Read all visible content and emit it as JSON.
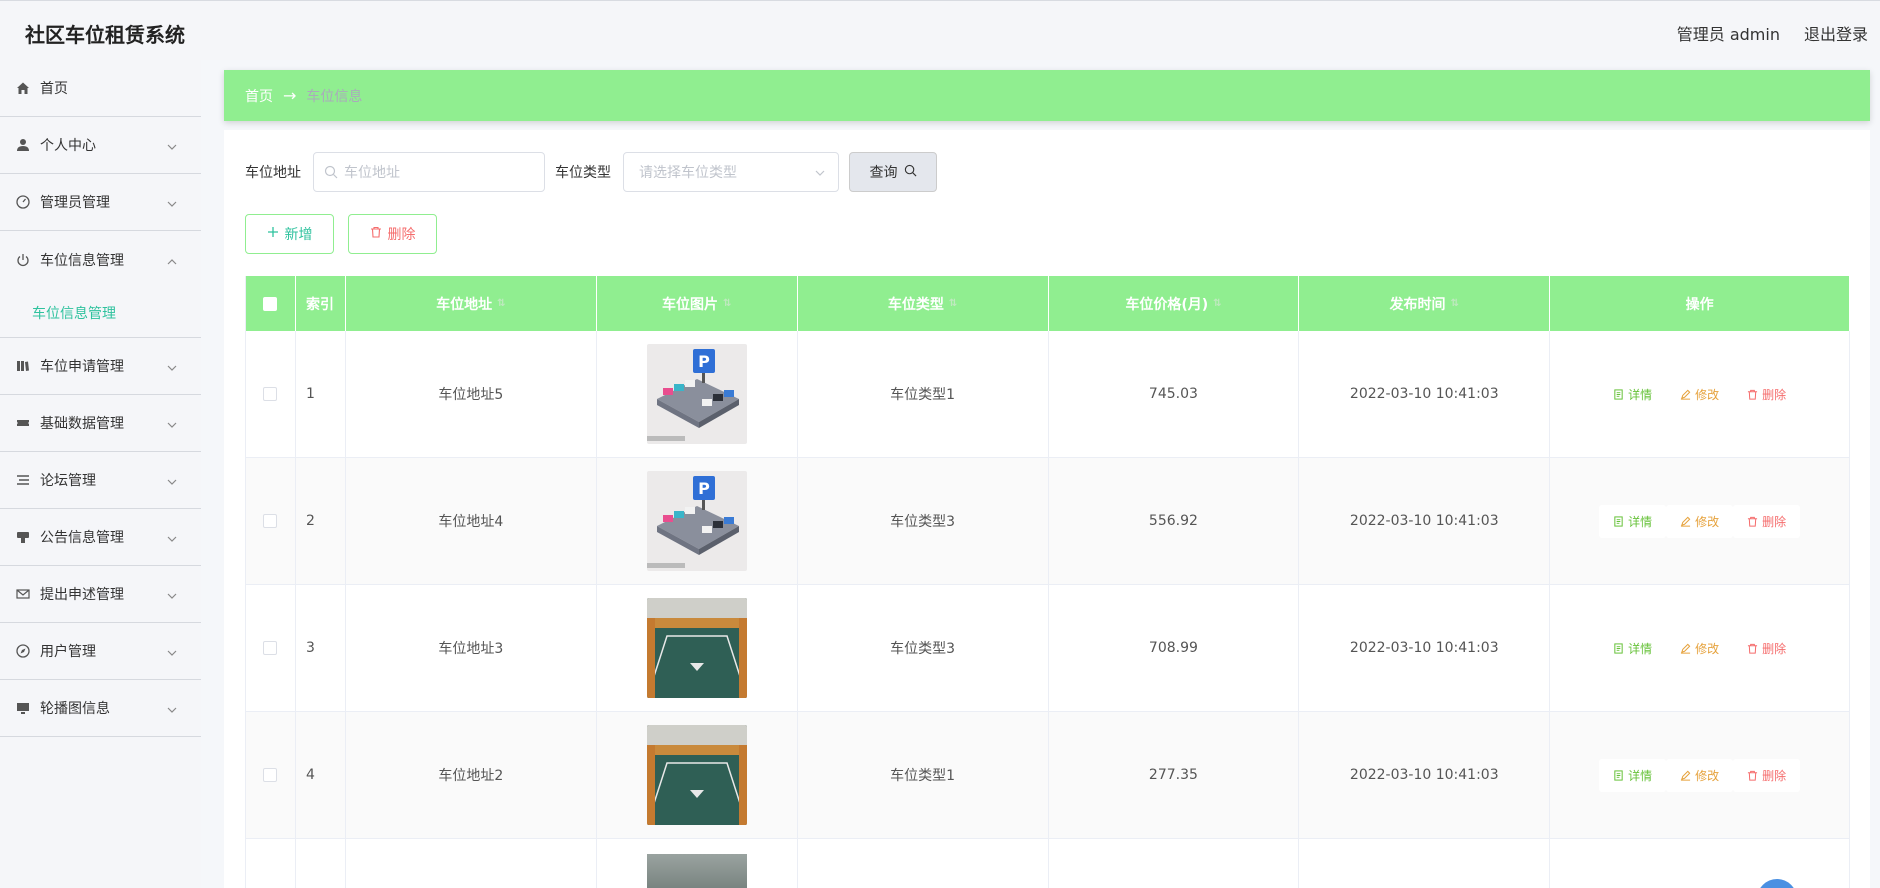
{
  "app": {
    "title": "社区车位租赁系统",
    "user_label": "管理员 admin",
    "logout_label": "退出登录"
  },
  "sidebar": {
    "items": [
      {
        "label": "首页",
        "icon": "home-icon"
      },
      {
        "label": "个人中心",
        "icon": "user-icon"
      },
      {
        "label": "管理员管理",
        "icon": "gauge-icon"
      },
      {
        "label": "车位信息管理",
        "icon": "power-icon",
        "expanded": true
      },
      {
        "label": "车位申请管理",
        "icon": "book-icon"
      },
      {
        "label": "基础数据管理",
        "icon": "ticket-icon"
      },
      {
        "label": "论坛管理",
        "icon": "list-icon"
      },
      {
        "label": "公告信息管理",
        "icon": "stamp-icon"
      },
      {
        "label": "提出申述管理",
        "icon": "mail-icon"
      },
      {
        "label": "用户管理",
        "icon": "compass-icon"
      },
      {
        "label": "轮播图信息",
        "icon": "monitor-icon"
      }
    ],
    "submenu_label": "车位信息管理"
  },
  "breadcrumb": {
    "home": "首页",
    "current": "车位信息"
  },
  "search": {
    "address_label": "车位地址",
    "address_placeholder": "车位地址",
    "type_label": "车位类型",
    "type_placeholder": "请选择车位类型",
    "query_label": "查询"
  },
  "toolbar": {
    "add_label": "新增",
    "delete_label": "删除"
  },
  "table": {
    "headers": {
      "index": "索引",
      "address": "车位地址",
      "image": "车位图片",
      "type": "车位类型",
      "price": "车位价格(月)",
      "time": "发布时间",
      "ops": "操作"
    },
    "rows": [
      {
        "index": "1",
        "address": "车位地址5",
        "image": "parking-illustration",
        "type": "车位类型1",
        "price": "745.03",
        "time": "2022-03-10 10:41:03"
      },
      {
        "index": "2",
        "address": "车位地址4",
        "image": "parking-illustration",
        "type": "车位类型3",
        "price": "556.92",
        "time": "2022-03-10 10:41:03"
      },
      {
        "index": "3",
        "address": "车位地址3",
        "image": "garage-photo",
        "type": "车位类型3",
        "price": "708.99",
        "time": "2022-03-10 10:41:03"
      },
      {
        "index": "4",
        "address": "车位地址2",
        "image": "garage-photo",
        "type": "车位类型1",
        "price": "277.35",
        "time": "2022-03-10 10:41:03"
      }
    ],
    "op_labels": {
      "detail": "详情",
      "edit": "修改",
      "remove": "删除"
    }
  },
  "colors": {
    "accent": "#90ee90",
    "active_text": "#2fc29e",
    "danger": "#f56c6c",
    "warning": "#e6a23c",
    "success": "#67c23a"
  }
}
